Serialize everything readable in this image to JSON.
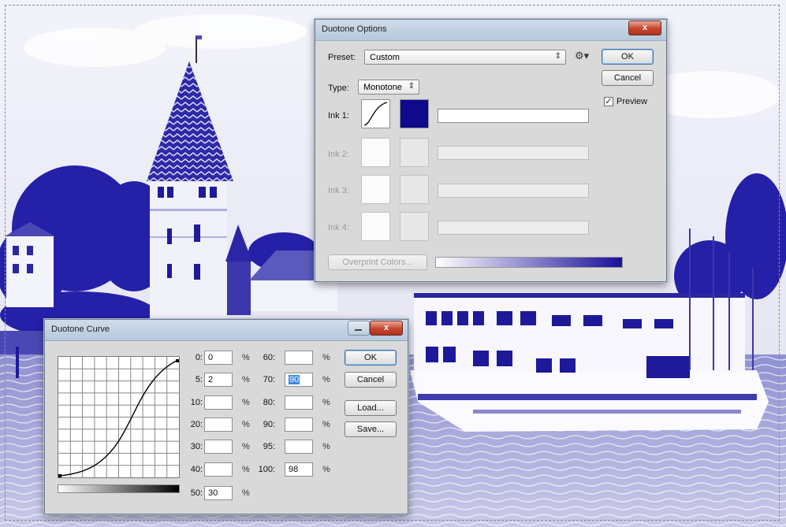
{
  "duotone_options": {
    "title": "Duotone Options",
    "close_label": "x",
    "preset_label": "Preset:",
    "preset_value": "Custom",
    "ok_label": "OK",
    "cancel_label": "Cancel",
    "preview_label": "Preview",
    "preview_checked": true,
    "type_label": "Type:",
    "type_value": "Monotone",
    "inks": [
      {
        "label": "Ink 1:",
        "name": "",
        "enabled": true,
        "color": "#0d0a8c"
      },
      {
        "label": "Ink 2:",
        "name": "",
        "enabled": false
      },
      {
        "label": "Ink 3:",
        "name": "",
        "enabled": false
      },
      {
        "label": "Ink 4:",
        "name": "",
        "enabled": false
      }
    ],
    "overprint_label": "Overprint Colors...",
    "gradient_end_color": "#1a0f9a"
  },
  "duotone_curve": {
    "title": "Duotone Curve",
    "close_label": "x",
    "ok_label": "OK",
    "cancel_label": "Cancel",
    "load_label": "Load...",
    "save_label": "Save...",
    "percent_symbol": "%",
    "left_column": [
      {
        "label": "0:",
        "value": "0"
      },
      {
        "label": "5:",
        "value": "2"
      },
      {
        "label": "10:",
        "value": ""
      },
      {
        "label": "20:",
        "value": ""
      },
      {
        "label": "30:",
        "value": ""
      },
      {
        "label": "40:",
        "value": ""
      },
      {
        "label": "50:",
        "value": "30"
      }
    ],
    "right_column": [
      {
        "label": "60:",
        "value": ""
      },
      {
        "label": "70:",
        "value": "90"
      },
      {
        "label": "80:",
        "value": ""
      },
      {
        "label": "90:",
        "value": ""
      },
      {
        "label": "95:",
        "value": ""
      },
      {
        "label": "100:",
        "value": "98"
      }
    ]
  },
  "colors": {
    "ink": "#1b14a0",
    "photo_bg": "#e9eaf5"
  }
}
